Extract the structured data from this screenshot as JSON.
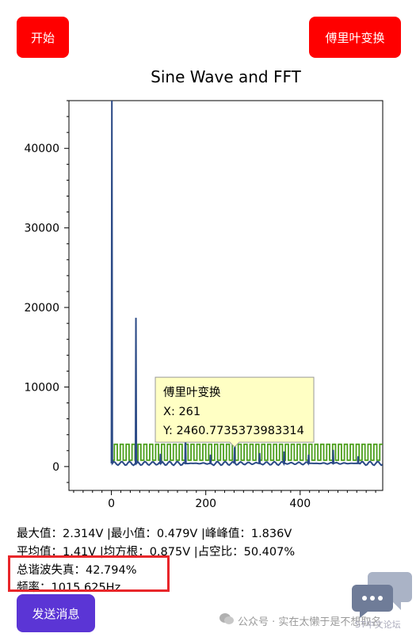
{
  "buttons": {
    "start": "开始",
    "fft": "傅里叶变换",
    "send": "发送消息"
  },
  "colors": {
    "button_red": "#ff0000",
    "button_purple": "#5b35d5",
    "fft_series": "#2b4a86",
    "sine_series": "#4b9e1a",
    "tooltip_bg": "#ffffc4",
    "highlight": "#e8262a"
  },
  "chart_data": {
    "type": "line",
    "title": "Sine Wave and FFT",
    "xlim": [
      -90,
      575
    ],
    "ylim": [
      -3000,
      46000
    ],
    "x_ticks": [
      0,
      200,
      400
    ],
    "y_ticks": [
      0,
      10000,
      20000,
      30000,
      40000
    ],
    "x_tick_labels": [
      "0",
      "200",
      "400"
    ],
    "y_tick_labels": [
      "0",
      "10000",
      "20000",
      "30000",
      "40000"
    ],
    "grid": false,
    "series": [
      {
        "type": "peaks",
        "baseline": 400,
        "x_range": [
          0,
          575
        ],
        "peaks": [
          {
            "x": 1,
            "y": 46000
          },
          {
            "x": 52,
            "y": 18700
          },
          {
            "x": 104,
            "y": 1600
          },
          {
            "x": 157,
            "y": 4300
          },
          {
            "x": 210,
            "y": 1500
          },
          {
            "x": 261,
            "y": 2460.7735373983314
          },
          {
            "x": 314,
            "y": 1700
          },
          {
            "x": 366,
            "y": 1900
          },
          {
            "x": 418,
            "y": 1500
          },
          {
            "x": 470,
            "y": 2100
          },
          {
            "x": 523,
            "y": 1300
          }
        ]
      },
      {
        "type": "square",
        "x_range": [
          0,
          575
        ],
        "low": 800,
        "high": 2800,
        "period": 12.5
      }
    ],
    "tooltip": {
      "title": "傅里叶变换",
      "x_text": "X: 261",
      "y_text": "Y: 2460.7735373983314",
      "x": 261,
      "y": 2460.7735373983314
    }
  },
  "stats": {
    "line1": "最大值：2.314V |最小值：0.479V |峰峰值：1.836V",
    "line2": "平均值：1.41V |均方根：0.875V |占空比：50.407%",
    "line3": "总谐波失真：42.794%",
    "line4": "频率：1015.625Hz"
  },
  "watermark": {
    "text": "公众号 · 实在太懒于是不想取名",
    "corner": "ST中文论坛"
  }
}
